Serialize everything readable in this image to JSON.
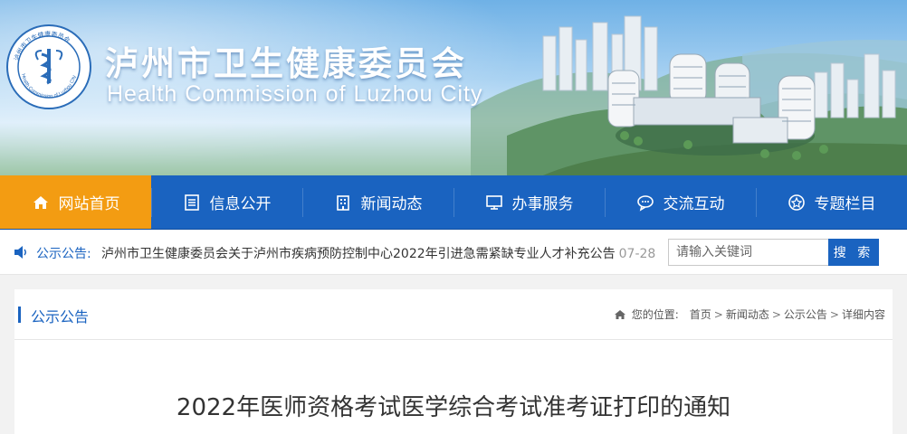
{
  "header": {
    "title_cn": "泸州市卫生健康委员会",
    "title_en": "Health Commission of Luzhou City",
    "seal_text": "Health Commission of Luzhou City"
  },
  "nav": {
    "items": [
      {
        "label": "网站首页",
        "icon": "home-icon",
        "active": true
      },
      {
        "label": "信息公开",
        "icon": "document-list-icon",
        "active": false
      },
      {
        "label": "新闻动态",
        "icon": "building-icon",
        "active": false
      },
      {
        "label": "办事服务",
        "icon": "monitor-icon",
        "active": false
      },
      {
        "label": "交流互动",
        "icon": "chat-bubble-icon",
        "active": false
      },
      {
        "label": "专题栏目",
        "icon": "star-circle-icon",
        "active": false
      }
    ]
  },
  "notice": {
    "label": "公示公告:",
    "text": "泸州市卫生健康委员会关于泸州市疾病预防控制中心2022年引进急需紧缺专业人才补充公告",
    "date": "07-28"
  },
  "search": {
    "placeholder": "请输入关键词",
    "button_label": "搜 索"
  },
  "section": {
    "title": "公示公告"
  },
  "breadcrumb": {
    "prefix": "您的位置:",
    "items": [
      "首页",
      "新闻动态",
      "公示公告",
      "详细内容"
    ]
  },
  "article": {
    "title": "2022年医师资格考试医学综合考试准考证打印的通知"
  },
  "colors": {
    "nav_blue": "#1a63c0",
    "active_orange": "#f39c12",
    "link_blue": "#1a63c0"
  }
}
